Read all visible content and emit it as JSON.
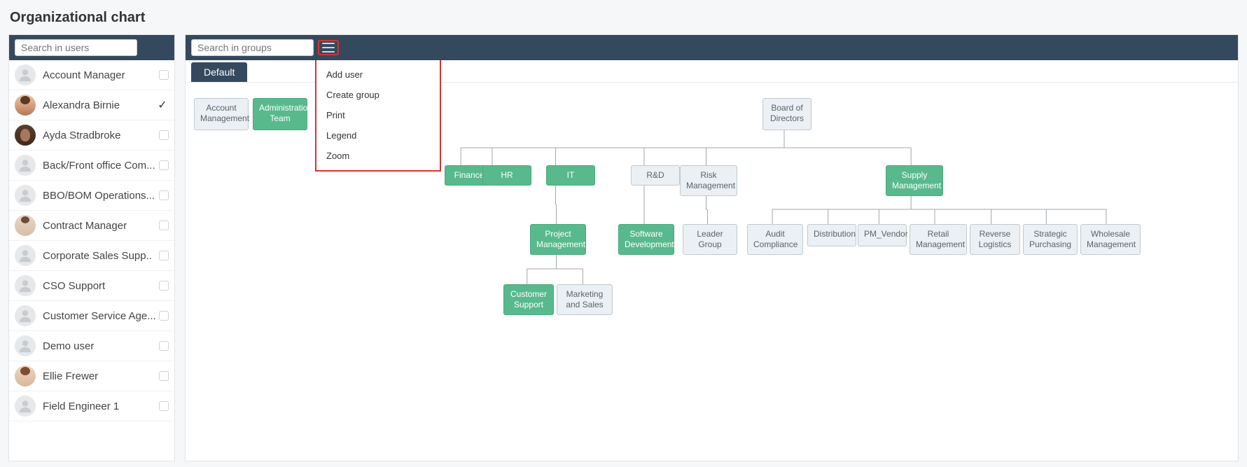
{
  "page_title": "Organizational chart",
  "sidebar": {
    "search_placeholder": "Search in users",
    "users": [
      {
        "label": "Account Manager",
        "avatar": "generic",
        "selected": false
      },
      {
        "label": "Alexandra Birnie",
        "avatar": "photo1",
        "selected": true
      },
      {
        "label": "Ayda Stradbroke",
        "avatar": "photo2",
        "selected": false
      },
      {
        "label": "Back/Front office Com...",
        "avatar": "generic",
        "selected": false
      },
      {
        "label": "BBO/BOM Operations...",
        "avatar": "generic",
        "selected": false
      },
      {
        "label": "Contract Manager",
        "avatar": "photo3",
        "selected": false
      },
      {
        "label": "Corporate Sales Supp..",
        "avatar": "generic",
        "selected": false
      },
      {
        "label": "CSO Support",
        "avatar": "generic",
        "selected": false
      },
      {
        "label": "Customer Service Age...",
        "avatar": "generic",
        "selected": false
      },
      {
        "label": "Demo user",
        "avatar": "generic",
        "selected": false
      },
      {
        "label": "Ellie Frewer",
        "avatar": "photo4",
        "selected": false
      },
      {
        "label": "Field Engineer 1",
        "avatar": "generic",
        "selected": false
      }
    ]
  },
  "main": {
    "search_placeholder": "Search in groups",
    "tab_label": "Default",
    "menu": {
      "items": [
        "Add user",
        "Create group",
        "Print",
        "Legend",
        "Zoom"
      ]
    }
  },
  "chart_data": {
    "type": "tree",
    "detached_left": [
      {
        "id": "acct_mgmt",
        "label": "Account Management",
        "style": "grey"
      },
      {
        "id": "admin_team",
        "label": "Administration Team",
        "style": "green"
      }
    ],
    "root": {
      "id": "board",
      "label": "Board of Directors",
      "style": "grey",
      "children": [
        {
          "id": "finance",
          "label": "Finance",
          "style": "green"
        },
        {
          "id": "hr",
          "label": "HR",
          "style": "green"
        },
        {
          "id": "it",
          "label": "IT",
          "style": "green",
          "children": [
            {
              "id": "proj_mgmt",
              "label": "Project Management",
              "style": "green",
              "children": [
                {
                  "id": "cust_supp",
                  "label": "Customer Support",
                  "style": "green"
                },
                {
                  "id": "mkt_sales",
                  "label": "Marketing and Sales",
                  "style": "grey"
                }
              ]
            }
          ]
        },
        {
          "id": "rnd",
          "label": "R&D",
          "style": "grey",
          "children": [
            {
              "id": "soft_dev",
              "label": "Software Development",
              "style": "green"
            }
          ]
        },
        {
          "id": "risk",
          "label": "Risk Management",
          "style": "grey",
          "children": [
            {
              "id": "leader_grp",
              "label": "Leader Group",
              "style": "grey"
            }
          ]
        },
        {
          "id": "supply",
          "label": "Supply Management",
          "style": "green",
          "children": [
            {
              "id": "audit",
              "label": "Audit Compliance",
              "style": "grey"
            },
            {
              "id": "dist",
              "label": "Distribution",
              "style": "grey"
            },
            {
              "id": "pm_vendor",
              "label": "PM_Vendor",
              "style": "grey"
            },
            {
              "id": "retail",
              "label": "Retail Management",
              "style": "grey"
            },
            {
              "id": "rev_log",
              "label": "Reverse Logistics",
              "style": "grey"
            },
            {
              "id": "strat_pur",
              "label": "Strategic Purchasing",
              "style": "grey"
            },
            {
              "id": "wholesale",
              "label": "Wholesale Management",
              "style": "grey"
            }
          ]
        }
      ]
    }
  }
}
